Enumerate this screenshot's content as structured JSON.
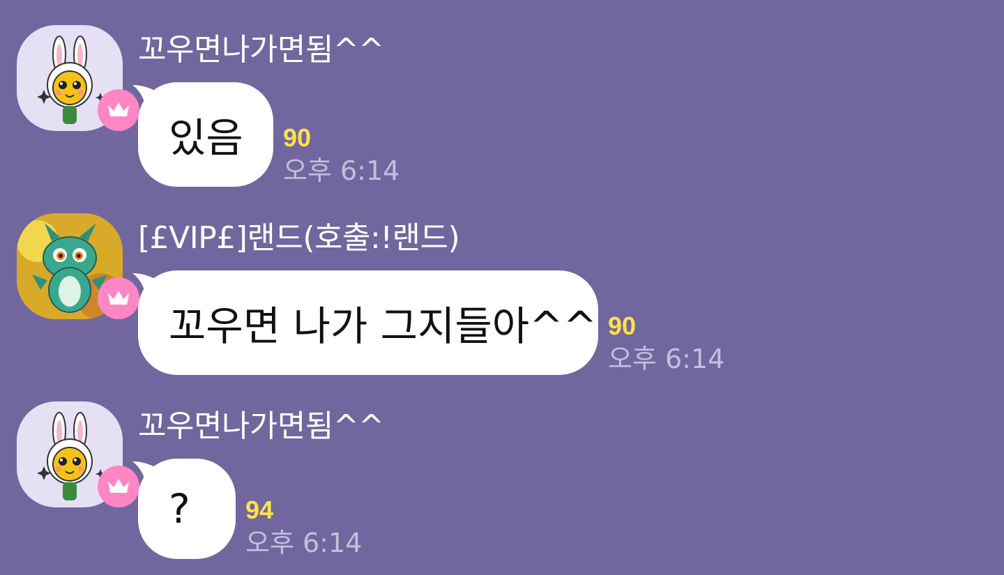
{
  "messages": [
    {
      "sender": "꼬우면나가면됨^^",
      "avatar_icon": "bunny-hood-character-icon",
      "badge_icon": "crown-icon",
      "text": "있음",
      "unread": "90",
      "time": "오후 6:14"
    },
    {
      "sender": "[£VIP£]랜드(호출:!랜드)",
      "avatar_icon": "green-dragon-character-icon",
      "badge_icon": "crown-icon",
      "text": "꼬우면 나가 그지들아^^",
      "unread": "90",
      "time": "오후 6:14"
    },
    {
      "sender": "꼬우면나가면됨^^",
      "avatar_icon": "bunny-hood-character-icon",
      "badge_icon": "crown-icon",
      "text": "?",
      "unread": "94",
      "time": "오후 6:14"
    }
  ],
  "colors": {
    "background": "#71679e",
    "bubble": "#ffffff",
    "unread": "#ffe24a",
    "time": "#c4bfdc",
    "badge": "#ff86c4"
  }
}
